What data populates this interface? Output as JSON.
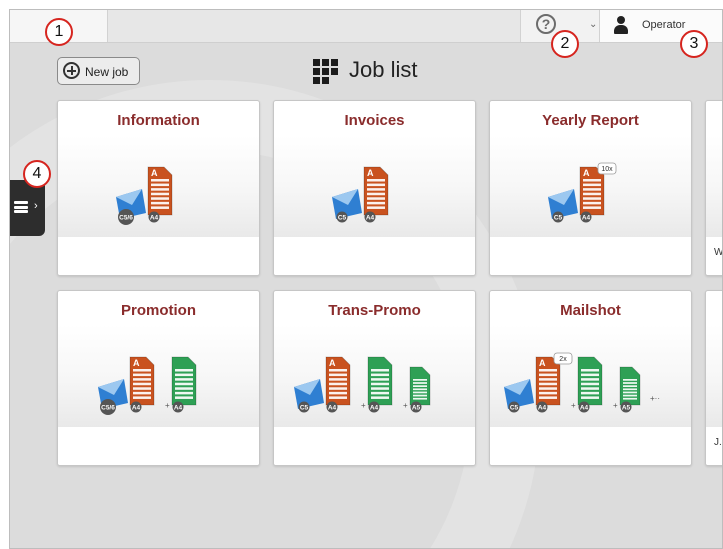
{
  "topbar": {
    "help_icon": "question-circle-icon",
    "user_name": "Operator"
  },
  "new_job_label": "New job",
  "page_title": "Job list",
  "cards": [
    {
      "title": "Information",
      "envelope": "C5/6",
      "sheets": [
        {
          "size": "A4",
          "color": "orange",
          "letter": "A"
        }
      ],
      "footer": ""
    },
    {
      "title": "Invoices",
      "envelope": "C5",
      "sheets": [
        {
          "size": "A4",
          "color": "orange",
          "letter": "A"
        }
      ],
      "footer": ""
    },
    {
      "title": "Yearly Report",
      "envelope": "C5",
      "sheets": [
        {
          "size": "A4",
          "color": "orange",
          "letter": "A",
          "badge": "10x"
        }
      ],
      "footer": ""
    },
    {
      "title": "",
      "footer": "W"
    },
    {
      "title": "Promotion",
      "envelope": "C5/6",
      "sheets": [
        {
          "size": "A4",
          "color": "orange",
          "letter": "A"
        },
        {
          "size": "A4",
          "color": "green"
        }
      ],
      "footer": ""
    },
    {
      "title": "Trans-Promo",
      "envelope": "C5",
      "sheets": [
        {
          "size": "A4",
          "color": "orange",
          "letter": "A"
        },
        {
          "size": "A4",
          "color": "green"
        },
        {
          "size": "A5",
          "color": "green"
        }
      ],
      "footer": ""
    },
    {
      "title": "Mailshot",
      "envelope": "C5",
      "sheets": [
        {
          "size": "A4",
          "color": "orange",
          "letter": "A",
          "badge": "2x"
        },
        {
          "size": "A4",
          "color": "green"
        },
        {
          "size": "A5",
          "color": "green"
        }
      ],
      "more": "+··",
      "footer": ""
    },
    {
      "title": "",
      "footer": "J."
    }
  ],
  "callouts": [
    "1",
    "2",
    "3",
    "4"
  ],
  "colors": {
    "title": "#8a2c2c",
    "orange_sheet": "#c9521f",
    "green_sheet": "#2ea055",
    "envelope": "#2f7fd2",
    "callout_ring": "#d6251f"
  }
}
